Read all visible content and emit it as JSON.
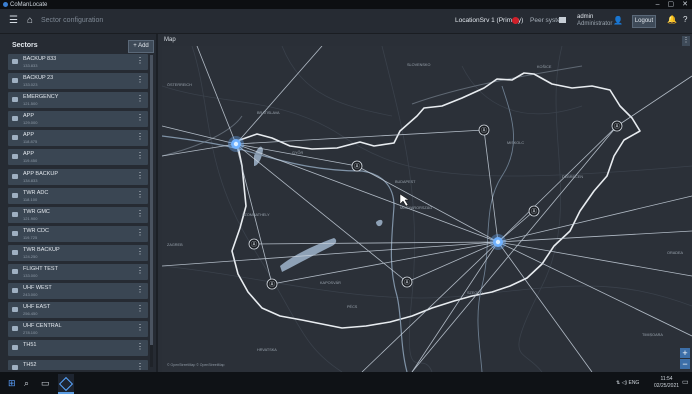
{
  "window": {
    "title": "CoManLocate",
    "controls": [
      "–",
      "▢",
      "✕"
    ]
  },
  "appbar": {
    "breadcrumb": "Sector configuration",
    "location": "LocationSrv 1 (Primary)",
    "peer_label": "Peer system",
    "user_name": "admin",
    "user_role": "Administrator",
    "logout_label": "Logout",
    "icons": {
      "menu": "☰",
      "home": "⌂",
      "user": "👤",
      "bell": "🔔",
      "help": "?"
    }
  },
  "sidebar": {
    "title": "Sectors",
    "add_label": "+ Add",
    "items": [
      {
        "name": "BACKUP 833",
        "freq": "133.833"
      },
      {
        "name": "BACKUP 23",
        "freq": "133.023"
      },
      {
        "name": "EMERGENCY",
        "freq": "121.500"
      },
      {
        "name": "APP",
        "freq": "129.000"
      },
      {
        "name": "APP",
        "freq": "118.875"
      },
      {
        "name": "APP",
        "freq": "119.450"
      },
      {
        "name": "APP BACKUP",
        "freq": "134.833"
      },
      {
        "name": "TWR ADC",
        "freq": "118.100"
      },
      {
        "name": "TWR GMC",
        "freq": "121.900"
      },
      {
        "name": "TWR CDC",
        "freq": "119.725"
      },
      {
        "name": "TWR BACKUP",
        "freq": "124.250"
      },
      {
        "name": "FLIGHT TEST",
        "freq": "133.000"
      },
      {
        "name": "UHF WEST",
        "freq": "243.000"
      },
      {
        "name": "UHF EAST",
        "freq": "256.450"
      },
      {
        "name": "UHF CENTRAL",
        "freq": "278.100"
      },
      {
        "name": "TH51",
        "freq": ""
      },
      {
        "name": "TH52",
        "freq": ""
      }
    ]
  },
  "map": {
    "title": "Map",
    "menu_icon": "⋮",
    "attribution": "© OpenStreetMap  © OpenStreetMap",
    "zoom_in": "+",
    "zoom_out": "−",
    "labels": [
      "SLOVENSKO",
      "KOŠICE",
      "MISKOLC",
      "DEBRECEN",
      "BUDAPEST",
      "MAGYARORSZÁG",
      "GYŐR",
      "SZOMBATHELY",
      "KAPOSVÁR",
      "PÉCS",
      "SZEGED",
      "ZAGREB",
      "HRVATSKA",
      "ORADEA",
      "TIMIȘOARA",
      "BRATISLAVA",
      "ÖSTERREICH"
    ],
    "colors": {
      "highlight": "#6fb1ff",
      "line": "#c9d3de",
      "border": "#e8ecf0",
      "water": "#8ea1b6"
    }
  },
  "taskbar": {
    "start": "⊞",
    "search": "⌕",
    "taskview": "▭",
    "tray": "⇅ ◁) ENG",
    "time": "11:54",
    "date": "02/25/2021"
  }
}
